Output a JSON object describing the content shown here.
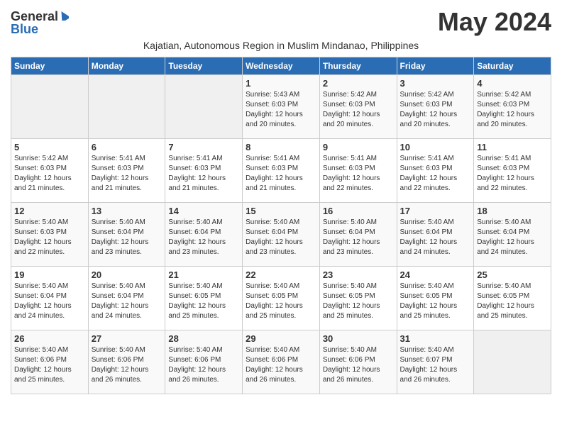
{
  "logo": {
    "general": "General",
    "blue": "Blue"
  },
  "title": "May 2024",
  "subtitle": "Kajatian, Autonomous Region in Muslim Mindanao, Philippines",
  "days_header": [
    "Sunday",
    "Monday",
    "Tuesday",
    "Wednesday",
    "Thursday",
    "Friday",
    "Saturday"
  ],
  "weeks": [
    [
      {
        "day": "",
        "info": ""
      },
      {
        "day": "",
        "info": ""
      },
      {
        "day": "",
        "info": ""
      },
      {
        "day": "1",
        "info": "Sunrise: 5:43 AM\nSunset: 6:03 PM\nDaylight: 12 hours\nand 20 minutes."
      },
      {
        "day": "2",
        "info": "Sunrise: 5:42 AM\nSunset: 6:03 PM\nDaylight: 12 hours\nand 20 minutes."
      },
      {
        "day": "3",
        "info": "Sunrise: 5:42 AM\nSunset: 6:03 PM\nDaylight: 12 hours\nand 20 minutes."
      },
      {
        "day": "4",
        "info": "Sunrise: 5:42 AM\nSunset: 6:03 PM\nDaylight: 12 hours\nand 20 minutes."
      }
    ],
    [
      {
        "day": "5",
        "info": "Sunrise: 5:42 AM\nSunset: 6:03 PM\nDaylight: 12 hours\nand 21 minutes."
      },
      {
        "day": "6",
        "info": "Sunrise: 5:41 AM\nSunset: 6:03 PM\nDaylight: 12 hours\nand 21 minutes."
      },
      {
        "day": "7",
        "info": "Sunrise: 5:41 AM\nSunset: 6:03 PM\nDaylight: 12 hours\nand 21 minutes."
      },
      {
        "day": "8",
        "info": "Sunrise: 5:41 AM\nSunset: 6:03 PM\nDaylight: 12 hours\nand 21 minutes."
      },
      {
        "day": "9",
        "info": "Sunrise: 5:41 AM\nSunset: 6:03 PM\nDaylight: 12 hours\nand 22 minutes."
      },
      {
        "day": "10",
        "info": "Sunrise: 5:41 AM\nSunset: 6:03 PM\nDaylight: 12 hours\nand 22 minutes."
      },
      {
        "day": "11",
        "info": "Sunrise: 5:41 AM\nSunset: 6:03 PM\nDaylight: 12 hours\nand 22 minutes."
      }
    ],
    [
      {
        "day": "12",
        "info": "Sunrise: 5:40 AM\nSunset: 6:03 PM\nDaylight: 12 hours\nand 22 minutes."
      },
      {
        "day": "13",
        "info": "Sunrise: 5:40 AM\nSunset: 6:04 PM\nDaylight: 12 hours\nand 23 minutes."
      },
      {
        "day": "14",
        "info": "Sunrise: 5:40 AM\nSunset: 6:04 PM\nDaylight: 12 hours\nand 23 minutes."
      },
      {
        "day": "15",
        "info": "Sunrise: 5:40 AM\nSunset: 6:04 PM\nDaylight: 12 hours\nand 23 minutes."
      },
      {
        "day": "16",
        "info": "Sunrise: 5:40 AM\nSunset: 6:04 PM\nDaylight: 12 hours\nand 23 minutes."
      },
      {
        "day": "17",
        "info": "Sunrise: 5:40 AM\nSunset: 6:04 PM\nDaylight: 12 hours\nand 24 minutes."
      },
      {
        "day": "18",
        "info": "Sunrise: 5:40 AM\nSunset: 6:04 PM\nDaylight: 12 hours\nand 24 minutes."
      }
    ],
    [
      {
        "day": "19",
        "info": "Sunrise: 5:40 AM\nSunset: 6:04 PM\nDaylight: 12 hours\nand 24 minutes."
      },
      {
        "day": "20",
        "info": "Sunrise: 5:40 AM\nSunset: 6:04 PM\nDaylight: 12 hours\nand 24 minutes."
      },
      {
        "day": "21",
        "info": "Sunrise: 5:40 AM\nSunset: 6:05 PM\nDaylight: 12 hours\nand 25 minutes."
      },
      {
        "day": "22",
        "info": "Sunrise: 5:40 AM\nSunset: 6:05 PM\nDaylight: 12 hours\nand 25 minutes."
      },
      {
        "day": "23",
        "info": "Sunrise: 5:40 AM\nSunset: 6:05 PM\nDaylight: 12 hours\nand 25 minutes."
      },
      {
        "day": "24",
        "info": "Sunrise: 5:40 AM\nSunset: 6:05 PM\nDaylight: 12 hours\nand 25 minutes."
      },
      {
        "day": "25",
        "info": "Sunrise: 5:40 AM\nSunset: 6:05 PM\nDaylight: 12 hours\nand 25 minutes."
      }
    ],
    [
      {
        "day": "26",
        "info": "Sunrise: 5:40 AM\nSunset: 6:06 PM\nDaylight: 12 hours\nand 25 minutes."
      },
      {
        "day": "27",
        "info": "Sunrise: 5:40 AM\nSunset: 6:06 PM\nDaylight: 12 hours\nand 26 minutes."
      },
      {
        "day": "28",
        "info": "Sunrise: 5:40 AM\nSunset: 6:06 PM\nDaylight: 12 hours\nand 26 minutes."
      },
      {
        "day": "29",
        "info": "Sunrise: 5:40 AM\nSunset: 6:06 PM\nDaylight: 12 hours\nand 26 minutes."
      },
      {
        "day": "30",
        "info": "Sunrise: 5:40 AM\nSunset: 6:06 PM\nDaylight: 12 hours\nand 26 minutes."
      },
      {
        "day": "31",
        "info": "Sunrise: 5:40 AM\nSunset: 6:07 PM\nDaylight: 12 hours\nand 26 minutes."
      },
      {
        "day": "",
        "info": ""
      }
    ]
  ]
}
